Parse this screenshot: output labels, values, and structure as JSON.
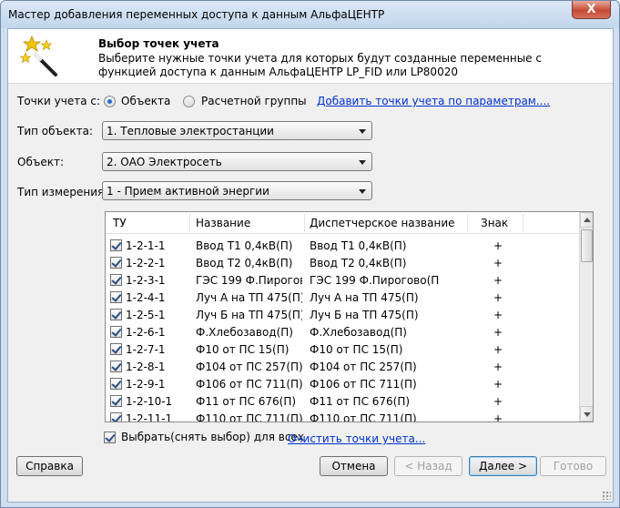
{
  "window": {
    "title": "Мастер добавления переменных доступа к данным АльфаЦЕНТР",
    "close_label": "X"
  },
  "header": {
    "title": "Выбор точек учета",
    "description": "Выберите нужные точки учета для которых будут созданные переменные с функцией доступа к данным АльфаЦЕНТР LP_FID или LP80020"
  },
  "points_source": {
    "label": "Точки учета с:",
    "option_object": "Объекта",
    "option_group": "Расчетной группы",
    "selected": "Объекта",
    "add_link": "Добавить точки учета по параметрам...."
  },
  "object_type": {
    "label": "Тип объекта:",
    "value": "1. Тепловые электростанции"
  },
  "object": {
    "label": "Объект:",
    "value": "2. ОАО Электросеть"
  },
  "measurement_type": {
    "label": "Тип измерения:",
    "value": "1 - Прием активной энергии"
  },
  "table": {
    "columns": [
      "ТУ",
      "Название",
      "Диспетчерское название",
      "Знак"
    ],
    "rows": [
      {
        "checked": true,
        "tu": "1-2-1-1",
        "name": "Ввод Т1 0,4кВ(П)",
        "dispatch": "Ввод Т1 0,4кВ(П)",
        "sign": "+"
      },
      {
        "checked": true,
        "tu": "1-2-2-1",
        "name": "Ввод Т2 0,4кВ(П)",
        "dispatch": "Ввод Т2 0,4кВ(П)",
        "sign": "+"
      },
      {
        "checked": true,
        "tu": "1-2-3-1",
        "name": "ГЭС 199 Ф.Пирогово(П)",
        "dispatch": "ГЭС 199 Ф.Пирогово(П",
        "sign": "+"
      },
      {
        "checked": true,
        "tu": "1-2-4-1",
        "name": "Луч А на ТП 475(П)",
        "dispatch": "Луч А на ТП 475(П)",
        "sign": "+"
      },
      {
        "checked": true,
        "tu": "1-2-5-1",
        "name": "Луч Б на ТП 475(П)",
        "dispatch": "Луч Б на ТП 475(П)",
        "sign": "+"
      },
      {
        "checked": true,
        "tu": "1-2-6-1",
        "name": "Ф.Хлебозавод(П)",
        "dispatch": "Ф.Хлебозавод(П)",
        "sign": "+"
      },
      {
        "checked": true,
        "tu": "1-2-7-1",
        "name": "Ф10 от ПС 15(П)",
        "dispatch": "Ф10 от ПС 15(П)",
        "sign": "+"
      },
      {
        "checked": true,
        "tu": "1-2-8-1",
        "name": "Ф104 от ПС 257(П)",
        "dispatch": "Ф104 от ПС 257(П)",
        "sign": "+"
      },
      {
        "checked": true,
        "tu": "1-2-9-1",
        "name": "Ф106 от ПС 711(П)",
        "dispatch": "Ф106 от ПС 711(П)",
        "sign": "+"
      },
      {
        "checked": true,
        "tu": "1-2-10-1",
        "name": "Ф11 от ПС 676(П)",
        "dispatch": "Ф11 от ПС 676(П)",
        "sign": "+"
      },
      {
        "checked": true,
        "tu": "1-2-11-1",
        "name": "Ф110 от ПС 711(П)",
        "dispatch": "Ф110 от ПС 711(П)",
        "sign": "+"
      }
    ]
  },
  "select_all": {
    "label": "Выбрать(снять выбор) для всех",
    "checked": true
  },
  "clear_link": "Очистить точки учета...",
  "buttons": {
    "help": "Справка",
    "cancel": "Отмена",
    "back": "< Назад",
    "next": "Далее >",
    "finish": "Готово"
  }
}
